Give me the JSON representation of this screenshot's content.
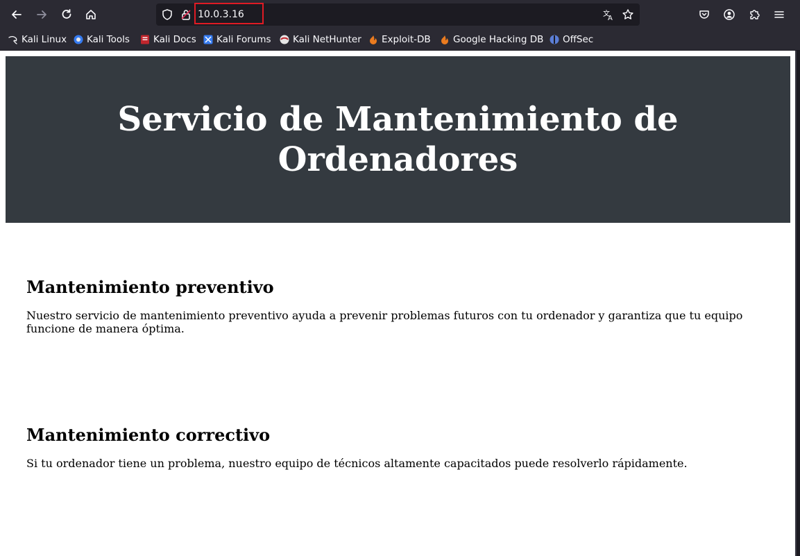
{
  "browser": {
    "url": "10.0.3.16",
    "bookmarks": [
      {
        "label": "Kali Linux",
        "icon": "kali-dragon-icon"
      },
      {
        "label": "Kali Tools",
        "icon": "kali-tools-icon"
      },
      {
        "label": "Kali Docs",
        "icon": "kali-docs-icon"
      },
      {
        "label": "Kali Forums",
        "icon": "kali-forums-icon"
      },
      {
        "label": "Kali NetHunter",
        "icon": "kali-nethunter-icon"
      },
      {
        "label": "Exploit-DB",
        "icon": "exploit-db-icon"
      },
      {
        "label": "Google Hacking DB",
        "icon": "google-hacking-db-icon"
      },
      {
        "label": "OffSec",
        "icon": "offsec-icon"
      }
    ],
    "highlight_color": "#e01b24"
  },
  "page": {
    "header_title": "Servicio de Mantenimiento de Ordenadores",
    "header_bg": "#343a40",
    "sections": [
      {
        "title": "Mantenimiento preventivo",
        "text": "Nuestro servicio de mantenimiento preventivo ayuda a prevenir problemas futuros con tu ordenador y garantiza que tu equipo funcione de manera óptima."
      },
      {
        "title": "Mantenimiento correctivo",
        "text": "Si tu ordenador tiene un problema, nuestro equipo de técnicos altamente capacitados puede resolverlo rápidamente."
      }
    ]
  }
}
